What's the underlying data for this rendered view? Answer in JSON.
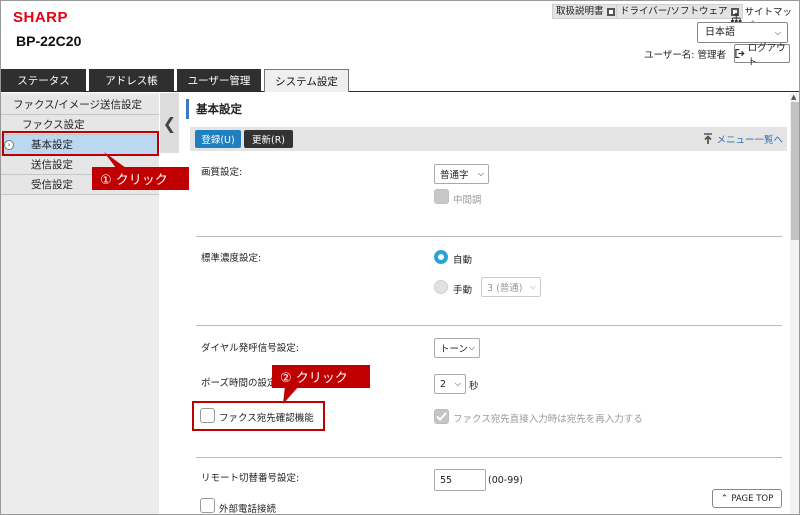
{
  "header": {
    "logo": "SHARP",
    "model": "BP-22C20",
    "manual_link": "取扱説明書",
    "driver_link": "ドライバー/ソフトウェア",
    "sitemap_link": "サイトマップ",
    "language": "日本語",
    "user_label": "ユーザー名: 管理者",
    "logout_label": "ログアウト"
  },
  "tabs": [
    {
      "label": "ステータス"
    },
    {
      "label": "アドレス帳"
    },
    {
      "label": "ユーザー管理"
    },
    {
      "label": "システム設定"
    }
  ],
  "sidebar": {
    "items": [
      {
        "label": "ファクス/イメージ送信設定"
      },
      {
        "label": "ファクス設定"
      },
      {
        "label": "基本設定"
      },
      {
        "label": "送信設定"
      },
      {
        "label": "受信設定"
      }
    ]
  },
  "main": {
    "title": "基本設定",
    "register_button": "登録(U)",
    "update_button": "更新(R)",
    "to_list": "メニュー一覧へ",
    "image_quality_label": "画質設定:",
    "image_quality_value": "普通字",
    "halftone_label": "中間調",
    "density_label": "標準濃度設定:",
    "density_auto": "自動",
    "density_manual": "手動",
    "density_manual_value": "3 (普通)",
    "dial_label": "ダイヤル発呼信号設定:",
    "dial_value": "トーン",
    "pause_label": "ポーズ時間の設定",
    "pause_value": "2",
    "pause_unit": "秒",
    "fax_confirm_label": "ファクス宛先確認機能",
    "fax_reenter_label": "ファクス宛先直接入力時は宛先を再入力する",
    "remote_label": "リモート切替番号設定:",
    "remote_value": "55",
    "remote_range": "(00-99)",
    "external_phone_label": "外部電話接続",
    "page_top": "PAGE TOP"
  },
  "callouts": {
    "first": "① クリック",
    "second": "② クリック"
  },
  "colors": {
    "brand": "#e60012",
    "accent_blue": "#1f7fc0",
    "callout_red": "#c00000",
    "active_sidebar": "#bcd7f0"
  }
}
